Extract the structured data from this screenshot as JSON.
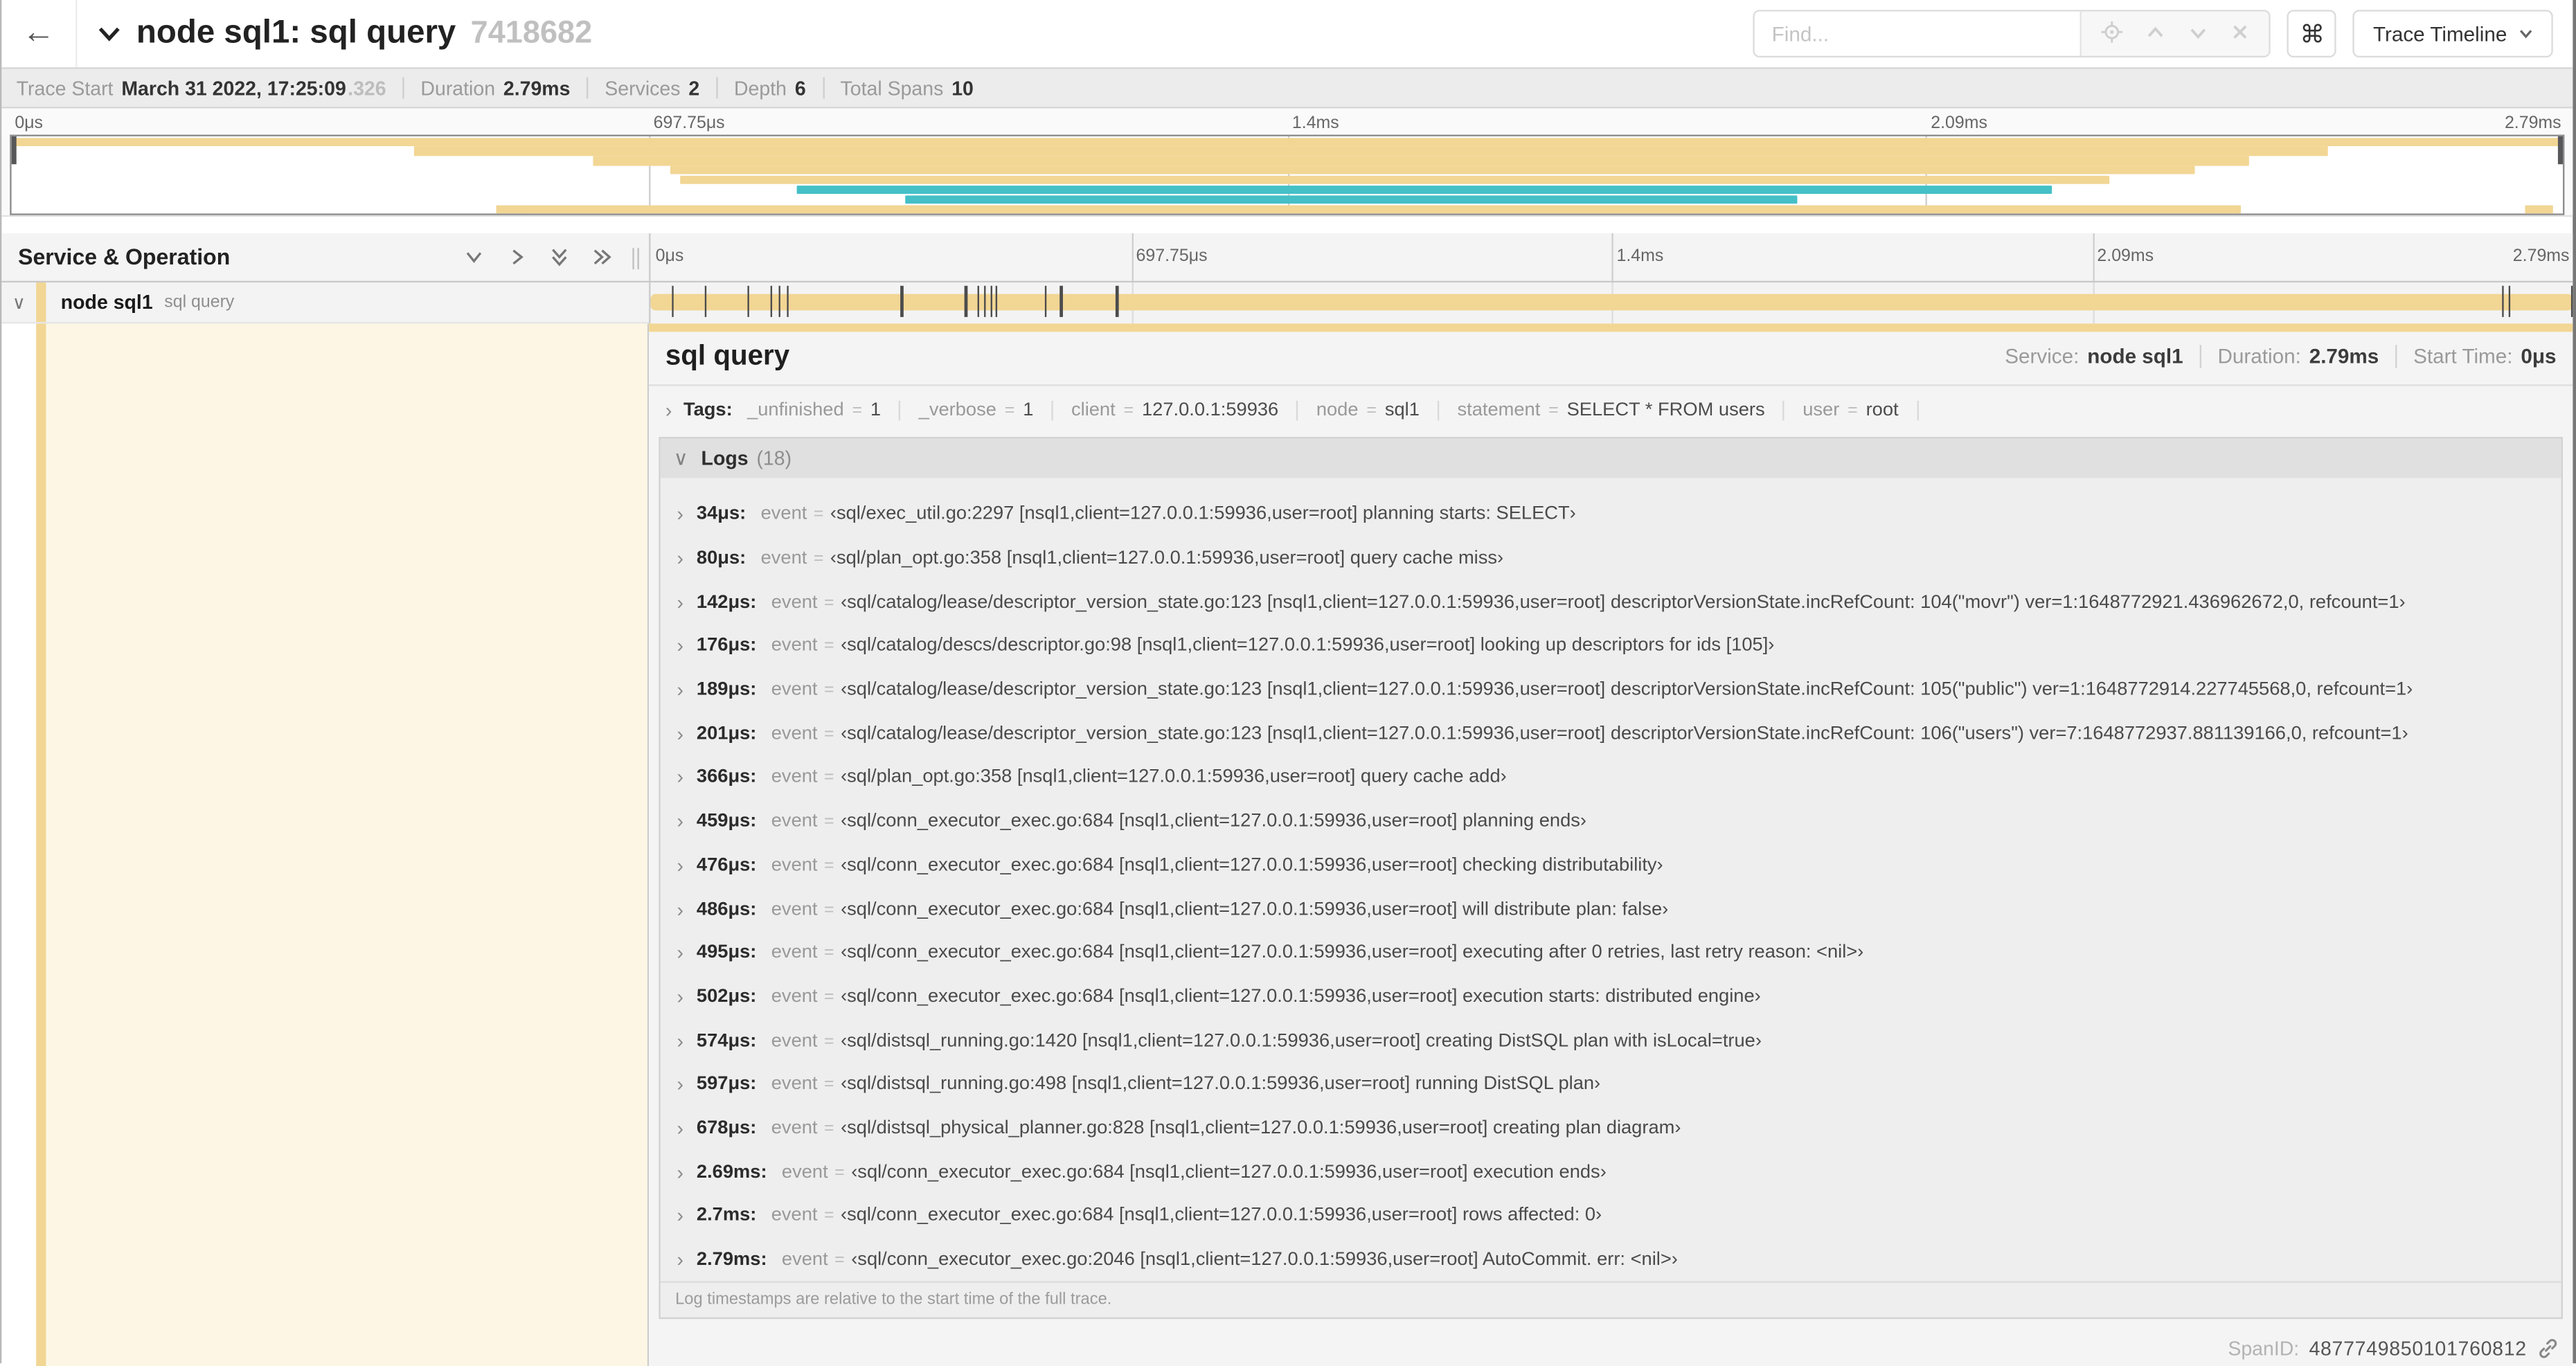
{
  "header": {
    "back": "←",
    "title": "node sql1: sql query",
    "trace_id_short": "7418682",
    "find_placeholder": "Find...",
    "cmd_label": "⌘",
    "trace_timeline_label": "Trace Timeline"
  },
  "trace_info": {
    "items": [
      {
        "label": "Trace Start",
        "value": "March 31 2022, 17:25:09",
        "suffix": ".326"
      },
      {
        "label": "Duration",
        "value": "2.79ms"
      },
      {
        "label": "Services",
        "value": "2"
      },
      {
        "label": "Depth",
        "value": "6"
      },
      {
        "label": "Total Spans",
        "value": "10"
      }
    ]
  },
  "ruler": {
    "labels": [
      {
        "label": "0μs",
        "pct": 0
      },
      {
        "label": "697.75μs",
        "pct": 25
      },
      {
        "label": "1.4ms",
        "pct": 50
      },
      {
        "label": "2.09ms",
        "pct": 75
      },
      {
        "label": "2.79ms",
        "pct": 100
      }
    ]
  },
  "colors": {
    "span_tan": "#F2D694",
    "span_teal": "#44C0C6",
    "detail_cream": "#FDF6E4"
  },
  "minimap": {
    "bars": [
      {
        "row": 0,
        "start": 0.0,
        "end": 1.0,
        "color": "tan"
      },
      {
        "row": 1,
        "start": 0.158,
        "end": 0.908,
        "color": "tan"
      },
      {
        "row": 2,
        "start": 0.228,
        "end": 0.877,
        "color": "tan"
      },
      {
        "row": 3,
        "start": 0.258,
        "end": 0.856,
        "color": "tan"
      },
      {
        "row": 4,
        "start": 0.262,
        "end": 0.822,
        "color": "tan"
      },
      {
        "row": 5,
        "start": 0.308,
        "end": 0.8,
        "color": "teal"
      },
      {
        "row": 6,
        "start": 0.35,
        "end": 0.7,
        "color": "teal"
      },
      {
        "row": 7,
        "start": 0.19,
        "end": 0.874,
        "color": "tan"
      },
      {
        "row": 7,
        "start": 0.985,
        "end": 0.996,
        "color": "tan"
      }
    ]
  },
  "left_panel": {
    "column_title": "Service & Operation",
    "service": "node sql1",
    "operation": "sql query"
  },
  "span_bar": {
    "total_us": 2790,
    "log_times_us": [
      34,
      80,
      142,
      176,
      189,
      201,
      366,
      459,
      476,
      486,
      495,
      502,
      574,
      597,
      678,
      2690,
      2700,
      2790
    ]
  },
  "span_detail": {
    "title": "sql query",
    "service_label": "Service:",
    "service": "node sql1",
    "duration_label": "Duration:",
    "duration": "2.79ms",
    "start_label": "Start Time:",
    "start": "0μs",
    "tags_label": "Tags:",
    "tags": [
      {
        "key": "_unfinished",
        "value": "1"
      },
      {
        "key": "_verbose",
        "value": "1"
      },
      {
        "key": "client",
        "value": "127.0.0.1:59936"
      },
      {
        "key": "node",
        "value": "sql1"
      },
      {
        "key": "statement",
        "value": "SELECT * FROM users"
      },
      {
        "key": "user",
        "value": "root"
      }
    ],
    "logs_label": "Logs",
    "logs_count": "(18)",
    "event_key": "event",
    "logs": [
      {
        "time": "34μs:",
        "msg": "‹sql/exec_util.go:2297 [nsql1,client=127.0.0.1:59936,user=root] planning starts: SELECT›"
      },
      {
        "time": "80μs:",
        "msg": "‹sql/plan_opt.go:358 [nsql1,client=127.0.0.1:59936,user=root] query cache miss›"
      },
      {
        "time": "142μs:",
        "msg": "‹sql/catalog/lease/descriptor_version_state.go:123 [nsql1,client=127.0.0.1:59936,user=root] descriptorVersionState.incRefCount: 104(\"movr\") ver=1:1648772921.436962672,0, refcount=1›"
      },
      {
        "time": "176μs:",
        "msg": "‹sql/catalog/descs/descriptor.go:98 [nsql1,client=127.0.0.1:59936,user=root] looking up descriptors for ids [105]›"
      },
      {
        "time": "189μs:",
        "msg": "‹sql/catalog/lease/descriptor_version_state.go:123 [nsql1,client=127.0.0.1:59936,user=root] descriptorVersionState.incRefCount: 105(\"public\") ver=1:1648772914.227745568,0, refcount=1›"
      },
      {
        "time": "201μs:",
        "msg": "‹sql/catalog/lease/descriptor_version_state.go:123 [nsql1,client=127.0.0.1:59936,user=root] descriptorVersionState.incRefCount: 106(\"users\") ver=7:1648772937.881139166,0, refcount=1›"
      },
      {
        "time": "366μs:",
        "msg": "‹sql/plan_opt.go:358 [nsql1,client=127.0.0.1:59936,user=root] query cache add›"
      },
      {
        "time": "459μs:",
        "msg": "‹sql/conn_executor_exec.go:684 [nsql1,client=127.0.0.1:59936,user=root] planning ends›"
      },
      {
        "time": "476μs:",
        "msg": "‹sql/conn_executor_exec.go:684 [nsql1,client=127.0.0.1:59936,user=root] checking distributability›"
      },
      {
        "time": "486μs:",
        "msg": "‹sql/conn_executor_exec.go:684 [nsql1,client=127.0.0.1:59936,user=root] will distribute plan: false›"
      },
      {
        "time": "495μs:",
        "msg": "‹sql/conn_executor_exec.go:684 [nsql1,client=127.0.0.1:59936,user=root] executing after 0 retries, last retry reason: <nil>›"
      },
      {
        "time": "502μs:",
        "msg": "‹sql/conn_executor_exec.go:684 [nsql1,client=127.0.0.1:59936,user=root] execution starts: distributed engine›"
      },
      {
        "time": "574μs:",
        "msg": "‹sql/distsql_running.go:1420 [nsql1,client=127.0.0.1:59936,user=root] creating DistSQL plan with isLocal=true›"
      },
      {
        "time": "597μs:",
        "msg": "‹sql/distsql_running.go:498 [nsql1,client=127.0.0.1:59936,user=root] running DistSQL plan›"
      },
      {
        "time": "678μs:",
        "msg": "‹sql/distsql_physical_planner.go:828 [nsql1,client=127.0.0.1:59936,user=root] creating plan diagram›"
      },
      {
        "time": "2.69ms:",
        "msg": "‹sql/conn_executor_exec.go:684 [nsql1,client=127.0.0.1:59936,user=root] execution ends›"
      },
      {
        "time": "2.7ms:",
        "msg": "‹sql/conn_executor_exec.go:684 [nsql1,client=127.0.0.1:59936,user=root] rows affected: 0›"
      },
      {
        "time": "2.79ms:",
        "msg": "‹sql/conn_executor_exec.go:2046 [nsql1,client=127.0.0.1:59936,user=root] AutoCommit. err: <nil>›"
      }
    ],
    "logs_footer": "Log timestamps are relative to the start time of the full trace.",
    "spanid_label": "SpanID:",
    "spanid": "4877749850101760812"
  }
}
